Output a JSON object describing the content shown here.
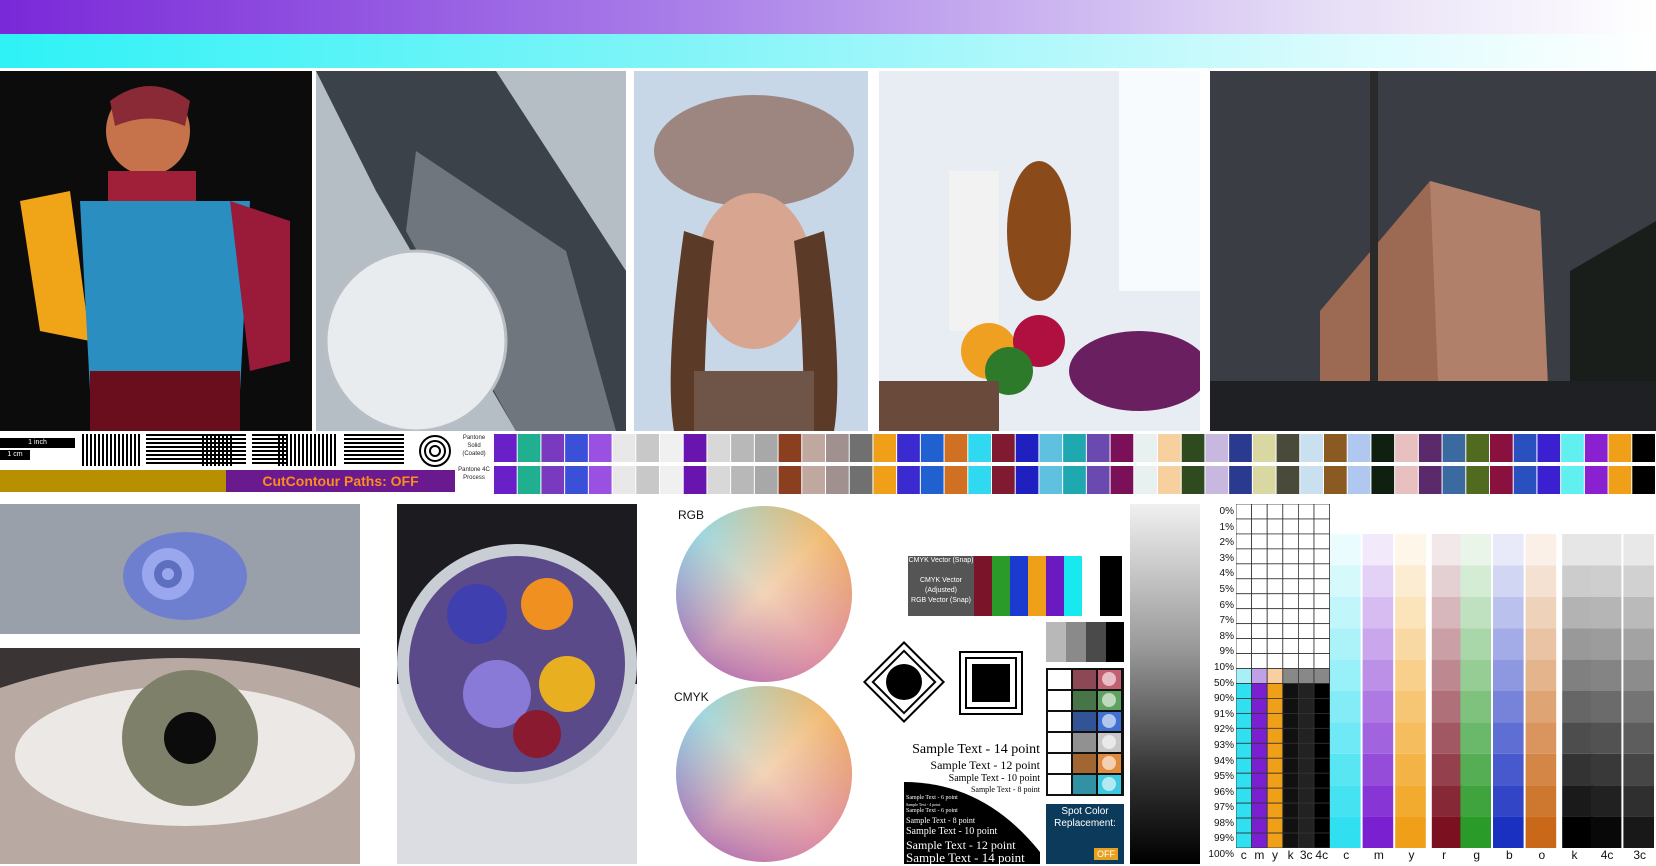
{
  "ruler": {
    "inch": "1 inch",
    "cm": "1 cm"
  },
  "cutcontour": {
    "label": "CutContour Paths:  OFF"
  },
  "swatch_rows": {
    "pantone_solid": "Pantone Solid (Coated)",
    "pantone_4c": "Pantone 4C Process"
  },
  "wheels": {
    "rgb": "RGB",
    "cmyk": "CMYK"
  },
  "vector_legend": [
    "CMYK Vector (Snap)",
    "CMYK Vector (Adjusted)",
    "RGB Vector (Snap)"
  ],
  "sample_text": [
    "Sample Text - 14 point",
    "Sample Text - 12 point",
    "Sample Text - 10 point",
    "Sample Text - 8 point",
    "Sample Text - 6 point",
    "Sample Text - 4 point",
    "Sample Text - 6 point",
    "Sample Text - 8 point",
    "Sample Text - 10 point",
    "Sample Text - 12 point",
    "Sample Text - 14 point"
  ],
  "spot_box": {
    "title": "Spot Color Replacement:",
    "state": "OFF"
  },
  "percent_labels": [
    "0%",
    "1%",
    "2%",
    "3%",
    "4%",
    "5%",
    "6%",
    "7%",
    "8%",
    "9%",
    "10%",
    "50%",
    "90%",
    "91%",
    "92%",
    "93%",
    "94%",
    "95%",
    "96%",
    "97%",
    "98%",
    "99%",
    "100%"
  ],
  "grid_columns": [
    "c",
    "m",
    "y",
    "k",
    "3c",
    "4c"
  ],
  "ramp_columns": [
    "c",
    "m",
    "y",
    "r",
    "g",
    "b",
    "o",
    "k",
    "4c",
    "3c"
  ],
  "colors": {
    "purple": "#7a28d8",
    "cyan": "#2ef2f6",
    "gold": "#b88f00",
    "cut_purple": "#6a1a8e",
    "cut_orange": "#ff8c1a"
  }
}
